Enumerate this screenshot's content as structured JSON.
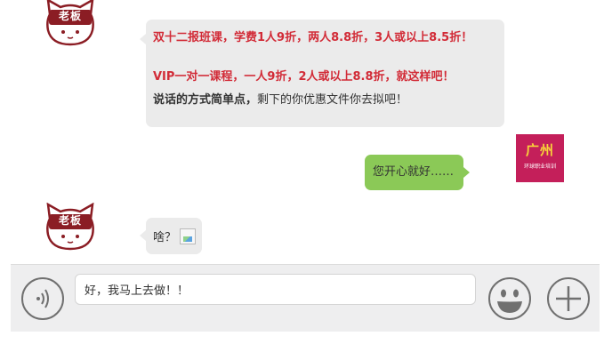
{
  "contacts": {
    "boss_avatar_label": "老板",
    "guangzhou_avatar": {
      "title": "广州",
      "subtitle": "环球职业培训"
    }
  },
  "messages": {
    "m1": {
      "line1": "双十二报班课，学费1人9折，两人8.8折，3人或以上8.5折！",
      "line2": "VIP一对一课程，一人9折，2人或以上8.8折，就这样吧！",
      "line3_bold": "说话的方式简单点，",
      "line3_rest": "剩下的你优惠文件你去拟吧！"
    },
    "m2": {
      "text": "您开心就好……"
    },
    "m3": {
      "text": "啥？"
    }
  },
  "input_bar": {
    "value": "好，我马上去做！！"
  },
  "icons": {
    "voice": "voice-icon",
    "emoji": "smiley-icon",
    "add": "plus-icon",
    "broken_image": "broken-image-icon"
  },
  "colors": {
    "accent_red": "#d22b37",
    "bubble_gray": "#ebebeb",
    "bubble_green": "#8bc957",
    "boss_dark_red": "#8b1d24",
    "logo_bg": "#c41f5a"
  }
}
